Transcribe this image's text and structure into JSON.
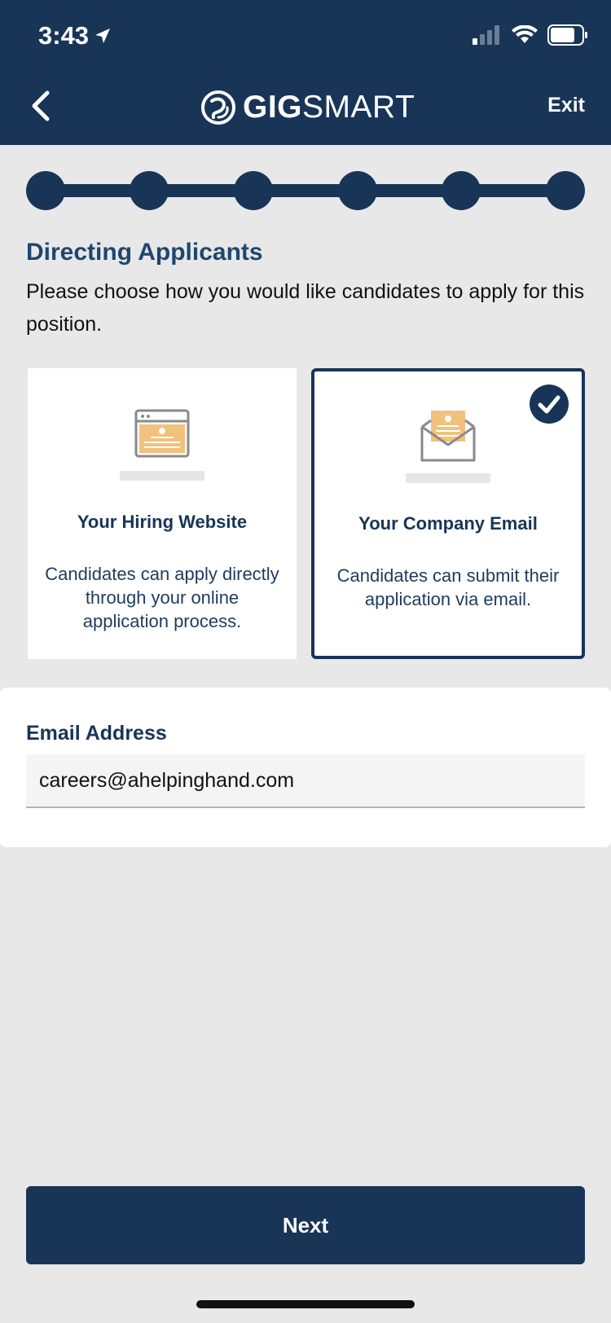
{
  "status_bar": {
    "time": "3:43"
  },
  "header": {
    "brand_bold": "GIG",
    "brand_light": "SMART",
    "exit_label": "Exit"
  },
  "stepper": {
    "total_steps": 6,
    "completed_steps": 6
  },
  "section": {
    "title": "Directing Applicants",
    "description": "Please choose how you would like candidates to apply for this position."
  },
  "options": [
    {
      "title": "Your Hiring Website",
      "description": "Candidates can apply directly through your online application process.",
      "selected": false
    },
    {
      "title": "Your Company Email",
      "description": "Candidates can submit their application via email.",
      "selected": true
    }
  ],
  "email": {
    "label": "Email Address",
    "value": "careers@ahelpinghand.com"
  },
  "footer": {
    "next_label": "Next"
  },
  "colors": {
    "navy": "#183557",
    "background": "#e8e8e9",
    "accent_orange": "#f0c27d"
  }
}
